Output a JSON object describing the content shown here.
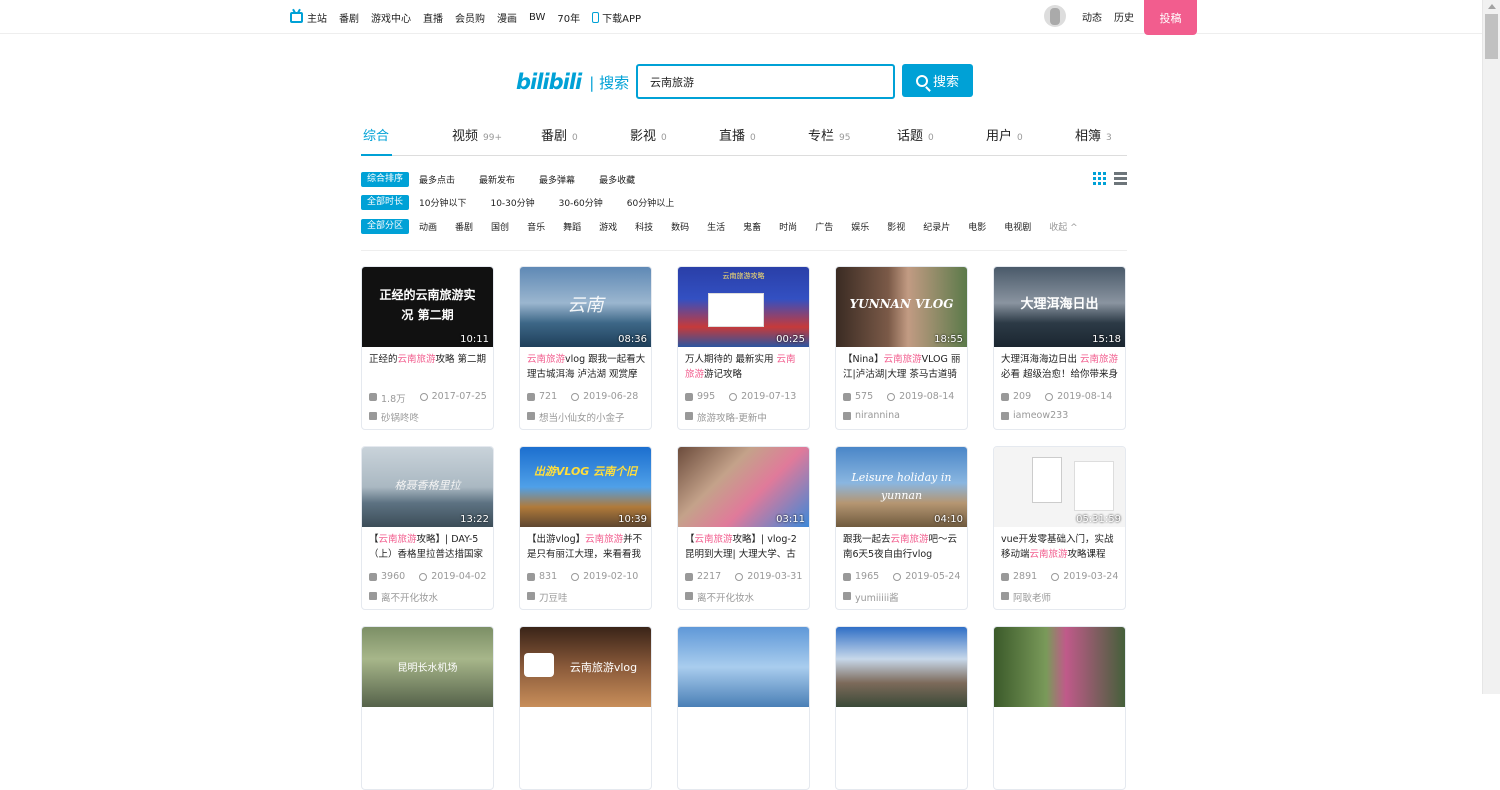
{
  "topnav": {
    "items": [
      "主站",
      "番剧",
      "游戏中心",
      "直播",
      "会员购",
      "漫画",
      "BW",
      "70年",
      "下载APP"
    ],
    "right": [
      "动态",
      "历史"
    ],
    "upload": "投稿"
  },
  "search": {
    "logo": "bilibili",
    "logo_suffix": "| 搜索",
    "query": "云南旅游",
    "button": "搜索"
  },
  "tabs": [
    {
      "label": "综合",
      "count": ""
    },
    {
      "label": "视频",
      "count": "99+"
    },
    {
      "label": "番剧",
      "count": "0"
    },
    {
      "label": "影视",
      "count": "0"
    },
    {
      "label": "直播",
      "count": "0"
    },
    {
      "label": "专栏",
      "count": "95"
    },
    {
      "label": "话题",
      "count": "0"
    },
    {
      "label": "用户",
      "count": "0"
    },
    {
      "label": "相簿",
      "count": "3"
    }
  ],
  "filters": {
    "sort": {
      "selected": "综合排序",
      "options": [
        "最多点击",
        "最新发布",
        "最多弹幕",
        "最多收藏"
      ]
    },
    "duration": {
      "selected": "全部时长",
      "options": [
        "10分钟以下",
        "10-30分钟",
        "30-60分钟",
        "60分钟以上"
      ]
    },
    "zone": {
      "selected": "全部分区",
      "options": [
        "动画",
        "番剧",
        "国创",
        "音乐",
        "舞蹈",
        "游戏",
        "科技",
        "数码",
        "生活",
        "鬼畜",
        "时尚",
        "广告",
        "娱乐",
        "影视",
        "纪录片",
        "电影",
        "电视剧"
      ],
      "collapse": "收起 ^"
    }
  },
  "videos": [
    {
      "thumb_text": "正经的云南旅游实况 第二期",
      "duration": "10:11",
      "title_pre": "正经的",
      "title_hl": "云南旅游",
      "title_post": "攻略 第二期",
      "views": "1.8万",
      "date": "2017-07-25",
      "uploader": "砂锅咚咚"
    },
    {
      "thumb_text": "云南",
      "duration": "08:36",
      "title_pre": "",
      "title_hl": "云南旅游",
      "title_post": "vlog 跟我一起看大理古城洱海 泸沽湖 观赏摩",
      "views": "721",
      "date": "2019-06-28",
      "uploader": "想当小仙女的小金子"
    },
    {
      "thumb_text": "云南旅游攻略",
      "duration": "00:25",
      "title_pre": "万人期待的 最新实用 ",
      "title_hl": "云南旅游",
      "title_post": "游记攻略",
      "views": "995",
      "date": "2019-07-13",
      "uploader": "旅游攻略-更新中"
    },
    {
      "thumb_text": "YUNNAN VLOG",
      "duration": "18:55",
      "title_pre": "【Nina】",
      "title_hl": "云南旅游",
      "title_post": "VLOG 丽江|泸沽湖|大理 茶马古道骑",
      "views": "575",
      "date": "2019-08-14",
      "uploader": "nirannina"
    },
    {
      "thumb_text": "大理洱海日出",
      "duration": "15:18",
      "title_pre": "大理洱海海边日出 ",
      "title_hl": "云南旅游",
      "title_post": "必看 超级治愈！给你带来身",
      "views": "209",
      "date": "2019-08-14",
      "uploader": "iameow233"
    },
    {
      "thumb_text": "格聂香格里拉",
      "duration": "13:22",
      "title_pre": "【",
      "title_hl": "云南旅游",
      "title_post": "攻略】| DAY-5（上）香格里拉普达措国家",
      "views": "3960",
      "date": "2019-04-02",
      "uploader": "离不开化妆水"
    },
    {
      "thumb_text": "出游VLOG 云南个旧",
      "duration": "10:39",
      "title_pre": "【出游vlog】",
      "title_hl": "云南旅游",
      "title_post": "并不是只有丽江大理，来看看我",
      "views": "831",
      "date": "2019-02-10",
      "uploader": "刀豆哇"
    },
    {
      "thumb_text": "",
      "duration": "03:11",
      "title_pre": "【",
      "title_hl": "云南旅游",
      "title_post": "攻略】| vlog-2 昆明到大理| 大理大学、古",
      "views": "2217",
      "date": "2019-03-31",
      "uploader": "离不开化妆水"
    },
    {
      "thumb_text": "Leisure holiday in yunnan",
      "duration": "04:10",
      "title_pre": "跟我一起去",
      "title_hl": "云南旅游",
      "title_post": "吧～云南6天5夜自由行vlog",
      "views": "1965",
      "date": "2019-05-24",
      "uploader": "yumiiiii酱"
    },
    {
      "thumb_text": "",
      "duration": "05:31:59",
      "title_pre": "vue开发零基础入门，实战移动端",
      "title_hl": "云南旅游",
      "title_post": "攻略课程",
      "views": "2891",
      "date": "2019-03-24",
      "uploader": "阿耿老师"
    },
    {
      "thumb_text": "昆明长水机场",
      "duration": "",
      "title_pre": "",
      "title_hl": "",
      "title_post": "",
      "views": "",
      "date": "",
      "uploader": ""
    },
    {
      "thumb_text": "云南旅游vlog",
      "duration": "",
      "title_pre": "",
      "title_hl": "",
      "title_post": "",
      "views": "",
      "date": "",
      "uploader": ""
    },
    {
      "thumb_text": "",
      "duration": "",
      "title_pre": "",
      "title_hl": "",
      "title_post": "",
      "views": "",
      "date": "",
      "uploader": ""
    },
    {
      "thumb_text": "",
      "duration": "",
      "title_pre": "",
      "title_hl": "",
      "title_post": "",
      "views": "",
      "date": "",
      "uploader": ""
    },
    {
      "thumb_text": "",
      "duration": "",
      "title_pre": "",
      "title_hl": "",
      "title_post": "",
      "views": "",
      "date": "",
      "uploader": ""
    }
  ],
  "colors": {
    "accent": "#00a1d6",
    "highlight": "#f25d8e"
  }
}
